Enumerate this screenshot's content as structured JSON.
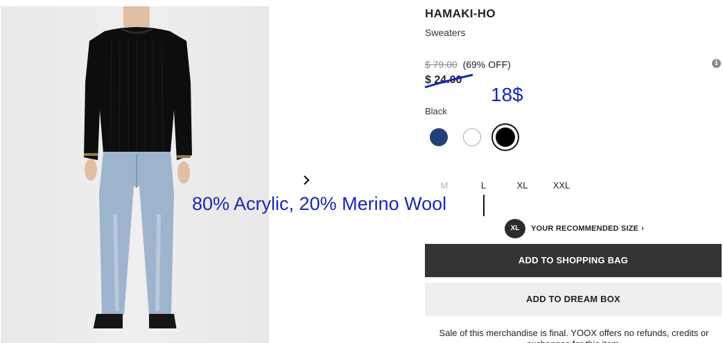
{
  "product": {
    "brand": "HAMAKI-HO",
    "category": "Sweaters",
    "original_price": "$ 79.00",
    "discount": "(69% OFF)",
    "sale_price": "$ 24.00",
    "price_info_icon": "info-icon",
    "image_alt": "Man wearing black ribbed sweater and light blue jeans"
  },
  "annotations": {
    "handwritten_price": "18$",
    "composition_text": "80% Acrylic, 20% Merino Wool",
    "color": "#1a27b4"
  },
  "color_selector": {
    "label": "Black",
    "swatches": [
      {
        "name": "navy",
        "hex": "#23407a",
        "selected": false
      },
      {
        "name": "white",
        "hex": "#ffffff",
        "selected": false
      },
      {
        "name": "black",
        "hex": "#000000",
        "selected": true
      }
    ]
  },
  "sizes": [
    {
      "label": "M",
      "available": false
    },
    {
      "label": "L",
      "available": true
    },
    {
      "label": "XL",
      "available": true
    },
    {
      "label": "XXL",
      "available": true
    }
  ],
  "recommended_size": {
    "badge": "XL",
    "label": "YOUR RECOMMENDED SIZE",
    "chevron": "›"
  },
  "actions": {
    "add_to_bag": "ADD TO SHOPPING BAG",
    "add_to_dream_box": "ADD TO DREAM BOX"
  },
  "disclaimer": "Sale of this merchandise is final. YOOX offers no refunds, credits or exchanges for this item.",
  "carousel": {
    "next_icon": "chevron-right-icon"
  }
}
